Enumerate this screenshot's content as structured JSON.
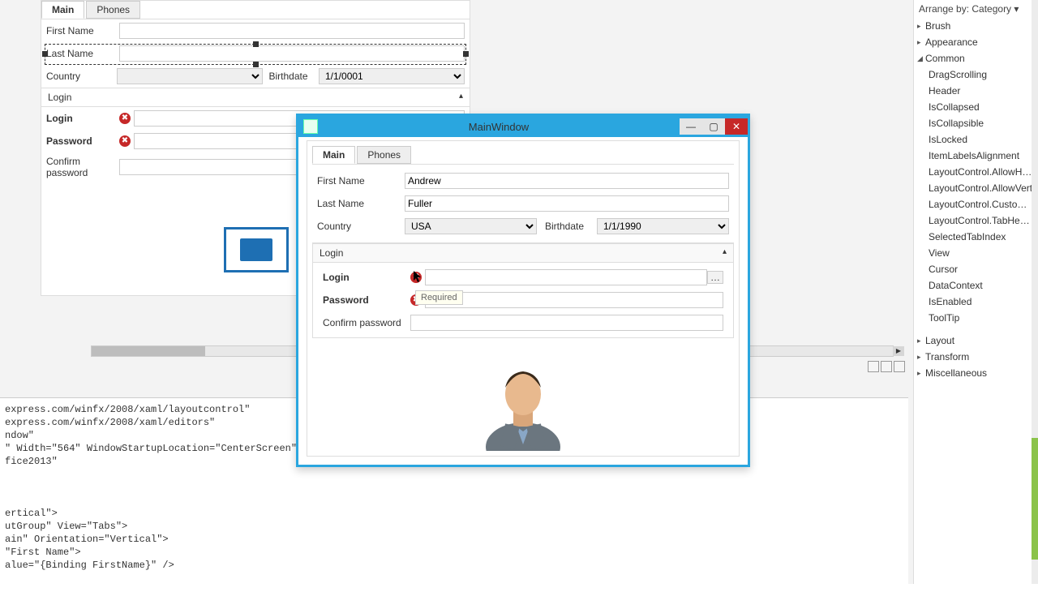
{
  "designer": {
    "tabs": [
      "Main",
      "Phones"
    ],
    "active_tab": 0,
    "fields": {
      "first_name_label": "First Name",
      "last_name_label": "Last Name",
      "country_label": "Country",
      "birthdate_label": "Birthdate",
      "birthdate_value": "1/1/0001"
    },
    "login_group": {
      "header": "Login",
      "login_label": "Login",
      "password_label": "Password",
      "confirm_label": "Confirm password"
    },
    "image_placeholder_alt": "image-placeholder"
  },
  "runwin": {
    "title": "MainWindow",
    "tabs": [
      "Main",
      "Phones"
    ],
    "active_tab": 0,
    "first_name_label": "First Name",
    "first_name_value": "Andrew",
    "last_name_label": "Last Name",
    "last_name_value": "Fuller",
    "country_label": "Country",
    "country_value": "USA",
    "birthdate_label": "Birthdate",
    "birthdate_value": "1/1/1990",
    "login_group": {
      "header": "Login",
      "login_label": "Login",
      "password_label": "Password",
      "confirm_label": "Confirm password",
      "required_tooltip": "Required"
    }
  },
  "code_snippet": "express.com/winfx/2008/xaml/layoutcontrol\"\nexpress.com/winfx/2008/xaml/editors\"\nndow\"\n\" Width=\"564\" WindowStartupLocation=\"CenterScreen\"\nfice2013\"\n\n\n\nertical\">\nutGroup\" View=\"Tabs\">\nain\" Orientation=\"Vertical\">\n\"First Name\">\nalue=\"{Binding FirstName}\" />",
  "properties": {
    "arrange_header": "Arrange by: Category ▾",
    "categories": [
      {
        "name": "Brush",
        "expanded": false,
        "items": []
      },
      {
        "name": "Appearance",
        "expanded": false,
        "items": []
      },
      {
        "name": "Common",
        "expanded": true,
        "items": [
          "DragScrolling",
          "Header",
          "IsCollapsed",
          "IsCollapsible",
          "IsLocked",
          "ItemLabelsAlignment",
          "LayoutControl.AllowHoriz",
          "LayoutControl.AllowVerti",
          "LayoutControl.Customiza",
          "LayoutControl.TabHeade",
          "SelectedTabIndex",
          "View",
          "Cursor",
          "DataContext",
          "IsEnabled",
          "ToolTip"
        ]
      },
      {
        "name": "Layout",
        "expanded": false,
        "items": []
      },
      {
        "name": "Transform",
        "expanded": false,
        "items": []
      },
      {
        "name": "Miscellaneous",
        "expanded": false,
        "items": []
      }
    ]
  }
}
